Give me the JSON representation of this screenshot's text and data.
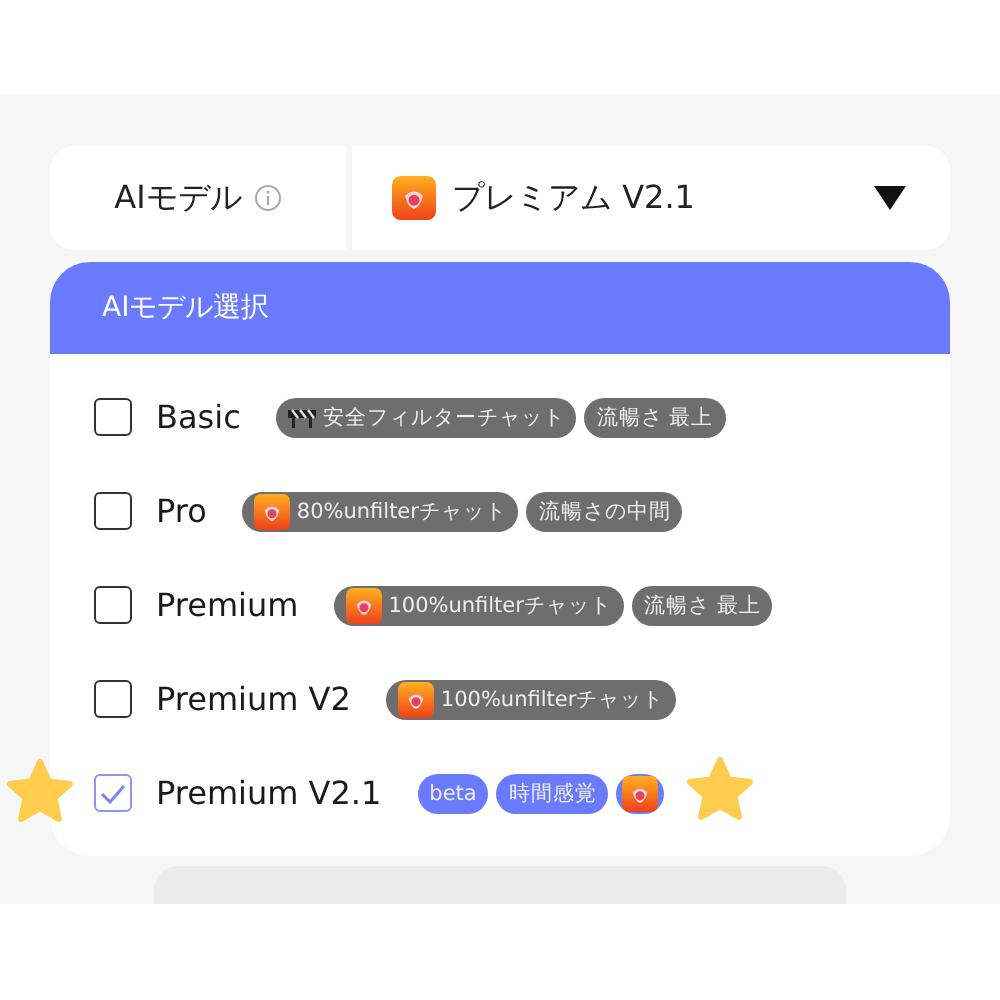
{
  "selector": {
    "label": "AIモデル",
    "value": "プレミアム V2.1"
  },
  "dropdown": {
    "title": "AIモデル選択",
    "options": [
      {
        "name": "Basic",
        "selected": false,
        "tags": [
          {
            "kind": "barrier",
            "text": "安全フィルターチャット",
            "color": "#6e6e6e"
          },
          {
            "kind": "text",
            "text": "流暢さ 最上",
            "color": "#6e6e6e"
          }
        ]
      },
      {
        "name": "Pro",
        "selected": false,
        "tags": [
          {
            "kind": "app",
            "text": "80%unfilterチャット",
            "color": "#6e6e6e"
          },
          {
            "kind": "text",
            "text": "流暢さの中間",
            "color": "#6e6e6e"
          }
        ]
      },
      {
        "name": "Premium",
        "selected": false,
        "tags": [
          {
            "kind": "app",
            "text": "100%unfilterチャット",
            "color": "#6e6e6e"
          },
          {
            "kind": "text",
            "text": "流暢さ 最上",
            "color": "#6e6e6e"
          }
        ]
      },
      {
        "name": "Premium V2",
        "selected": false,
        "tags": [
          {
            "kind": "app",
            "text": "100%unfilterチャット",
            "color": "#6e6e6e"
          }
        ]
      },
      {
        "name": "Premium V2.1",
        "selected": true,
        "tags": [
          {
            "kind": "text",
            "text": "beta",
            "color": "#6b7bff"
          },
          {
            "kind": "text",
            "text": "時間感覚",
            "color": "#6b7bff"
          },
          {
            "kind": "app-only",
            "color": "#6b7bff"
          }
        ]
      }
    ]
  }
}
